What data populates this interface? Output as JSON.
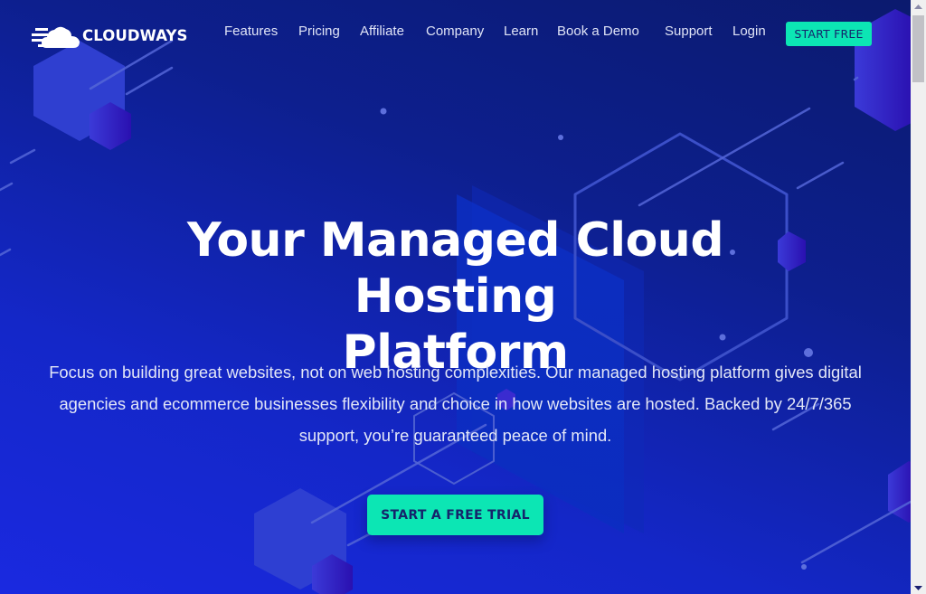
{
  "brand": {
    "name": "CLOUDWAYS",
    "logo_icon": "cloud-speed-icon"
  },
  "nav": {
    "items": [
      {
        "label": "Features"
      },
      {
        "label": "Pricing"
      },
      {
        "label": "Affiliate"
      },
      {
        "label": "Company"
      },
      {
        "label": "Learn"
      },
      {
        "label": "Book a Demo"
      },
      {
        "label": "Support"
      },
      {
        "label": "Login"
      }
    ],
    "cta_label": "START FREE"
  },
  "hero": {
    "headline_line1": "Your Managed Cloud Hosting",
    "headline_line2": "Platform",
    "subtext": "Focus on building great websites, not on web hosting complexities. Our managed hosting platform gives digital agencies and ecommerce businesses flexibility and choice in how websites are hosted. Backed by 24/7/365 support, you’re guaranteed peace of mind.",
    "cta_label": "START A FREE TRIAL"
  },
  "colors": {
    "accent": "#0ce6b4",
    "accent_text": "#15246b",
    "background_dark": "#0b1a6e",
    "background_bright": "#1a29e0"
  },
  "scrollbar": {
    "up_icon": "scroll-up-arrow-icon",
    "down_icon": "scroll-down-arrow-icon"
  }
}
